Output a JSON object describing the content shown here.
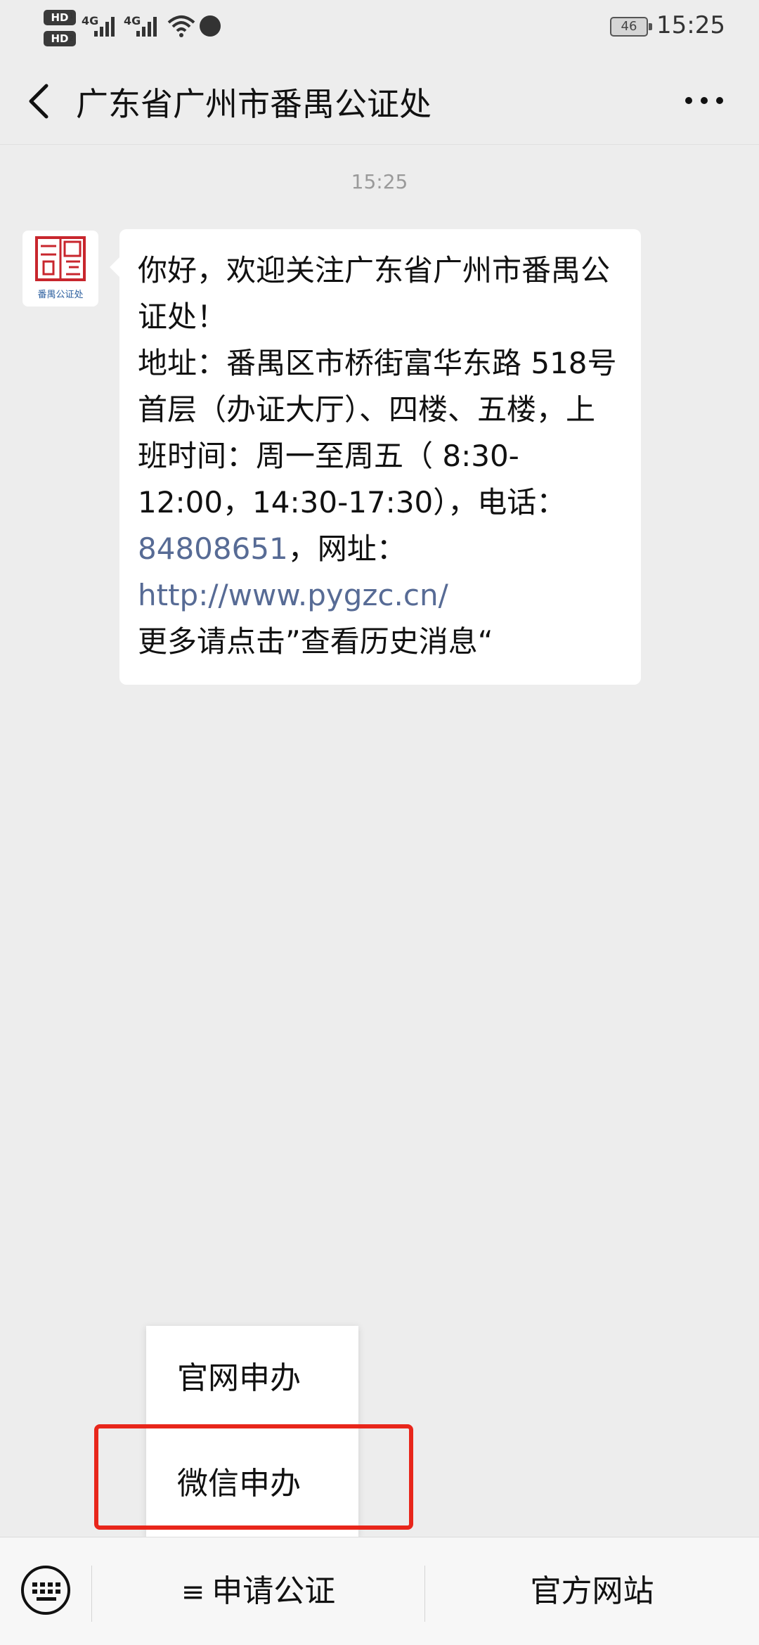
{
  "status_bar": {
    "sim1_label": "HD",
    "sim1_index": "1",
    "sim2_label": "HD",
    "sim2_index": "2",
    "network1": "4G",
    "network2": "4G",
    "battery_level": "46",
    "clock": "15:25"
  },
  "header": {
    "title": "广东省广州市番禺公证处",
    "back_icon": "chevron-left-icon",
    "more_icon": "more-dots-icon"
  },
  "chat": {
    "timestamp": "15:25",
    "avatar_text": "番禺公证处",
    "message": {
      "line1": "你好，欢迎关注广东省广州市番禺公证处！",
      "address": "地址：番禺区市桥街富华东路 518号首层（办证大厅）、四楼、五楼，上班时间：周一至周五（ 8:30-12:00，14:30-17:30），电话：",
      "phone": "84808651",
      "site_label": "，网址：",
      "url": "http://www.pygzc.cn/",
      "more": "更多请点击”查看历史消息“"
    }
  },
  "popup_menu": {
    "items": [
      "官网申办",
      "微信申办"
    ],
    "highlighted_item": "微信申办",
    "highlight_color": "#e8261b"
  },
  "bottom_menu": {
    "keyboard_icon": "keyboard-icon",
    "menu1_icon": "≡",
    "menu1_label": "申请公证",
    "menu2_label": "官方网站"
  },
  "colors": {
    "background": "#ededed",
    "link": "#576b95",
    "seal_red": "#c8262d"
  }
}
